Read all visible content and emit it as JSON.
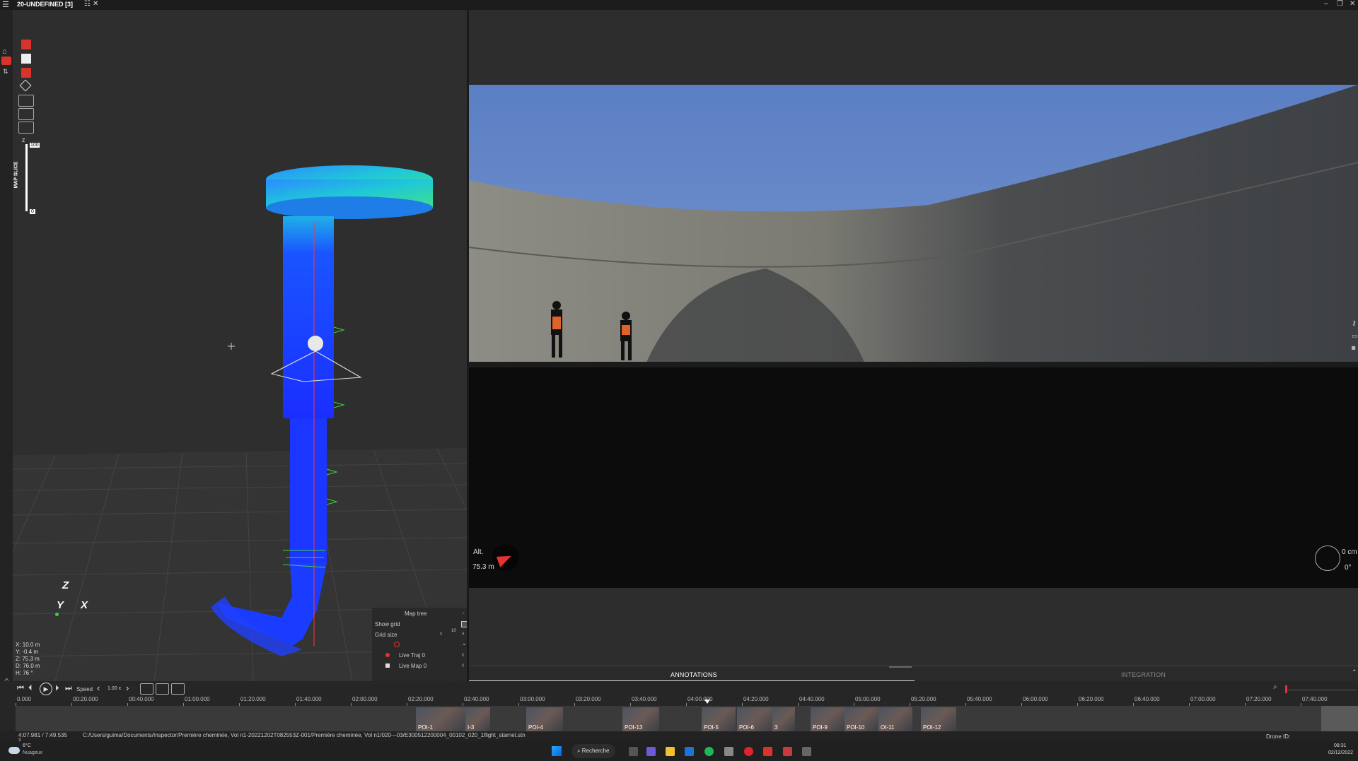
{
  "app": {
    "title": "20-UNDEFINED [3]",
    "menu_icon": "hamburger-icon",
    "close_tab": "✕"
  },
  "window_controls": [
    "–",
    "❐",
    "✕"
  ],
  "viewport": {
    "map_slice_label": "MAP SLICE",
    "slice_top": "100",
    "slice_bottom": "0",
    "slice_z": "Z",
    "axes": {
      "z": "Z",
      "y": "Y",
      "x": "X"
    },
    "coords": [
      "X:  10.0 m",
      "Y:  -0.4 m",
      "Z:  75.3 m",
      "D: 76.0 m",
      "H:    76 °"
    ],
    "map_tree": {
      "title": "Map tree",
      "collapse": "-",
      "show_grid": "Show grid",
      "grid_size": "Grid size",
      "grid_value": "10",
      "items": [
        "Live Traj 0",
        "Live Map 0"
      ]
    }
  },
  "photo": {
    "alt_label": "Alt.",
    "alt_value": "75.3 m",
    "right_value": "0 cm",
    "right_deg": "0°"
  },
  "tabs": [
    "ANNOTATIONS",
    "INTEGRATION"
  ],
  "timeline": {
    "speed_label": "Speed",
    "speed_value": "1.00 x",
    "ticks": [
      "0.000",
      "00:20.000",
      "00:40.000",
      "01:00.000",
      "01:20.000",
      "01:40.000",
      "02:00.000",
      "02:20.000",
      "02:40.000",
      "03:00.000",
      "03:20.000",
      "03:40.000",
      "04:00.000",
      "04:20.000",
      "04:40.000",
      "05:00.000",
      "05:20.000",
      "05:40.000",
      "06:00.000",
      "06:20.000",
      "06:40.000",
      "07:00.000",
      "07:20.000",
      "07:40.000"
    ],
    "pois": [
      "POI-1",
      "I-3",
      "POI-4",
      "POI-13",
      "POI-5",
      "POI-6",
      "3",
      "POI-9",
      "POI-10",
      "OI-11",
      "POI-12"
    ]
  },
  "status": {
    "time": "4:07.981 / 7:49.535",
    "frame": "3",
    "path": "C:/Users/guima/Documents/Inspector/Première cheminée, Vol n1-20221202T082553Z-001/Première cheminée, Vol n1/020---03/E300512200004_00102_020_1flight_starnet.stn",
    "drone_id": "Drone ID:"
  },
  "taskbar": {
    "weather_temp": "6°C",
    "weather_desc": "Nuageux",
    "search": "Recherche",
    "clock_time": "08:31",
    "clock_date": "02/12/2022"
  },
  "colors": {
    "accent_red": "#e63232",
    "pointcloud_blue": "#1a3cff",
    "pointcloud_cyan": "#1fc8d8"
  }
}
